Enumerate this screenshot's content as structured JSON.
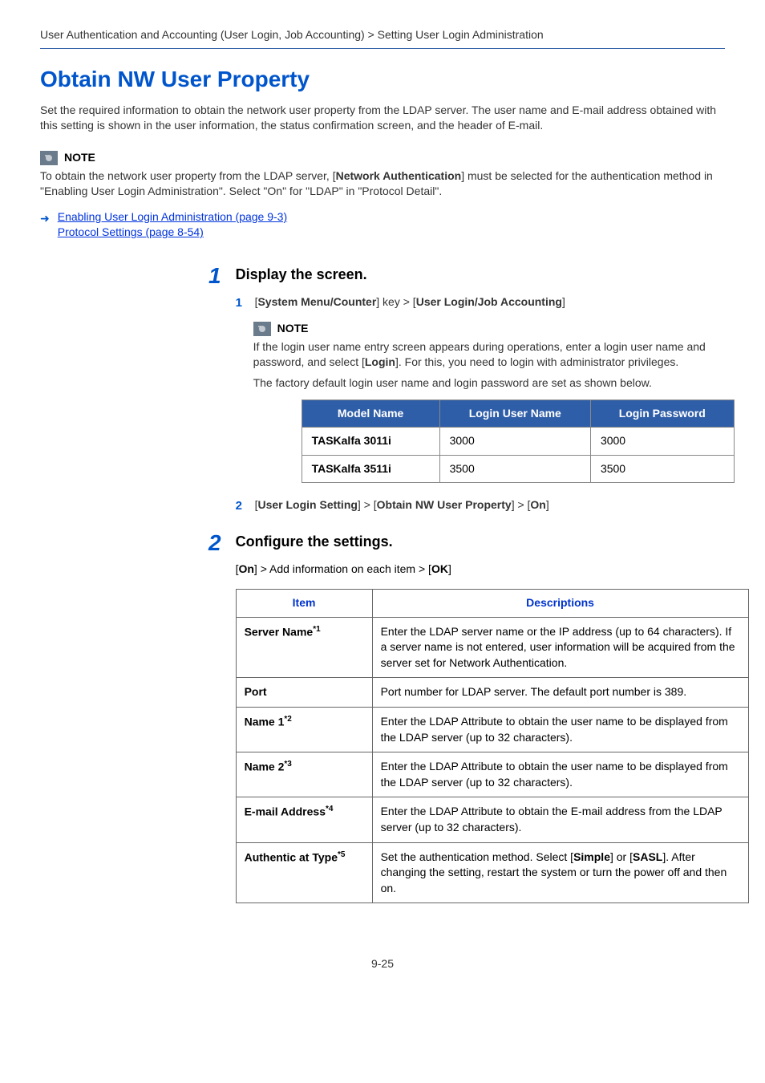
{
  "breadcrumb": "User Authentication and Accounting (User Login, Job Accounting) > Setting User Login Administration",
  "page_title": "Obtain NW User Property",
  "intro": "Set the required information to obtain the network user property from the LDAP server. The user name and E-mail address obtained with this setting is shown in the user information, the status confirmation screen, and the header of E-mail.",
  "note1": {
    "label": "NOTE",
    "text_parts": {
      "pre": "To obtain the network user property from the LDAP server, [",
      "bold": "Network Authentication",
      "post": "] must be selected for the authentication method in \"Enabling User Login Administration\". Select \"On\" for \"LDAP\" in \"Protocol Detail\"."
    }
  },
  "links": {
    "a": "Enabling User Login Administration (page 9-3)",
    "b": "Protocol Settings (page 8-54)"
  },
  "step1": {
    "num": "1",
    "title": "Display the screen.",
    "sub1": {
      "num": "1",
      "pre": "[",
      "b1": "System Menu/Counter",
      "mid": "] key > [",
      "b2": "User Login/Job Accounting",
      "post": "]"
    },
    "note": {
      "label": "NOTE",
      "p1_pre": "If the login user name entry screen appears during operations, enter a login user name and password, and select [",
      "p1_bold": "Login",
      "p1_post": "]. For this, you need to login with administrator privileges.",
      "p2": "The factory default login user name and login password are set as shown below."
    },
    "table": {
      "headers": [
        "Model Name",
        "Login User Name",
        "Login Password"
      ],
      "rows": [
        [
          "TASKalfa 3011i",
          "3000",
          "3000"
        ],
        [
          "TASKalfa 3511i",
          "3500",
          "3500"
        ]
      ]
    },
    "sub2": {
      "num": "2",
      "pre": "[",
      "b1": "User Login Setting",
      "mid1": "] > [",
      "b2": "Obtain NW User Property",
      "mid2": "] > [",
      "b3": "On",
      "post": "]"
    }
  },
  "step2": {
    "num": "2",
    "title": "Configure the settings.",
    "line": {
      "pre": "[",
      "b1": "On",
      "mid": "] > Add information on each item > [",
      "b2": "OK",
      "post": "]"
    },
    "table": {
      "headers": [
        "Item",
        "Descriptions"
      ],
      "rows": [
        {
          "item": "Server Name",
          "sup": "*1",
          "desc": "Enter the LDAP server name or the IP address (up to 64 characters). If a server name is not entered, user information will be acquired from the server set for Network Authentication."
        },
        {
          "item": "Port",
          "sup": "",
          "desc": "Port number for LDAP server. The default port number is 389."
        },
        {
          "item": "Name 1",
          "sup": "*2",
          "desc": "Enter the LDAP Attribute to obtain the user name to be displayed from the LDAP server (up to 32 characters)."
        },
        {
          "item": "Name 2",
          "sup": "*3",
          "desc": "Enter the LDAP Attribute to obtain the user name to be displayed from the LDAP server (up to 32 characters)."
        },
        {
          "item": "E-mail Address",
          "sup": "*4",
          "desc": "Enter the LDAP Attribute to obtain the E-mail address from the LDAP server (up to 32 characters)."
        },
        {
          "item": "Authentic at Type",
          "sup": "*5",
          "desc_parts": {
            "pre": "Set the authentication method. Select [",
            "b1": "Simple",
            "mid": "] or [",
            "b2": "SASL",
            "post": "]. After changing the setting, restart the system or turn the power off and then on."
          }
        }
      ]
    }
  },
  "page_num": "9-25"
}
